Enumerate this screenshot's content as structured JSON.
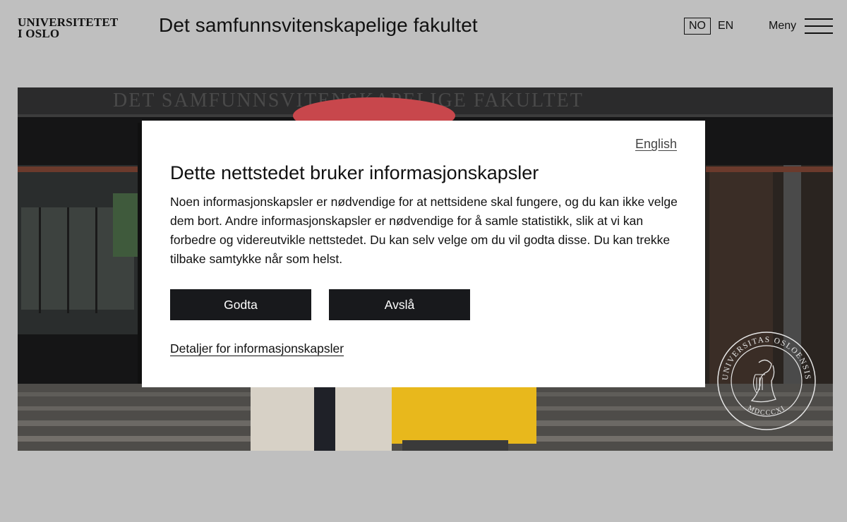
{
  "header": {
    "logo_line1": "UNIVERSITETET",
    "logo_line2": "I OSLO",
    "faculty_title": "Det samfunnsvitenskapelige fakultet",
    "lang_no": "NO",
    "lang_en": "EN",
    "menu_label": "Meny"
  },
  "hero": {
    "building_inscription": "DET SAMFUNNSVITENSKAPELIGE FAKULTET",
    "seal_text_top": "UNIVERSITAS OSLOENSIS",
    "seal_text_bottom": "MDCCCXI"
  },
  "cookie_dialog": {
    "language_link": "English",
    "title": "Dette nettstedet bruker informasjonskapsler",
    "body": "Noen informasjonskapsler er nødvendige for at nettsidene skal fungere, og du kan ikke velge dem bort. Andre informasjonskapsler er nødvendige for å samle statistikk, slik at vi kan forbedre og videreutvikle nettstedet. Du kan selv velge om du vil godta disse. Du kan trekke tilbake samtykke når som helst.",
    "accept_label": "Godta",
    "decline_label": "Avslå",
    "details_link": "Detaljer for informasjonskapsler"
  },
  "colors": {
    "page_background": "#bfbfbf",
    "dialog_background": "#ffffff",
    "button_background": "#18191c",
    "umbrella": "#c8474c",
    "raincoat": "#e8b81c"
  }
}
